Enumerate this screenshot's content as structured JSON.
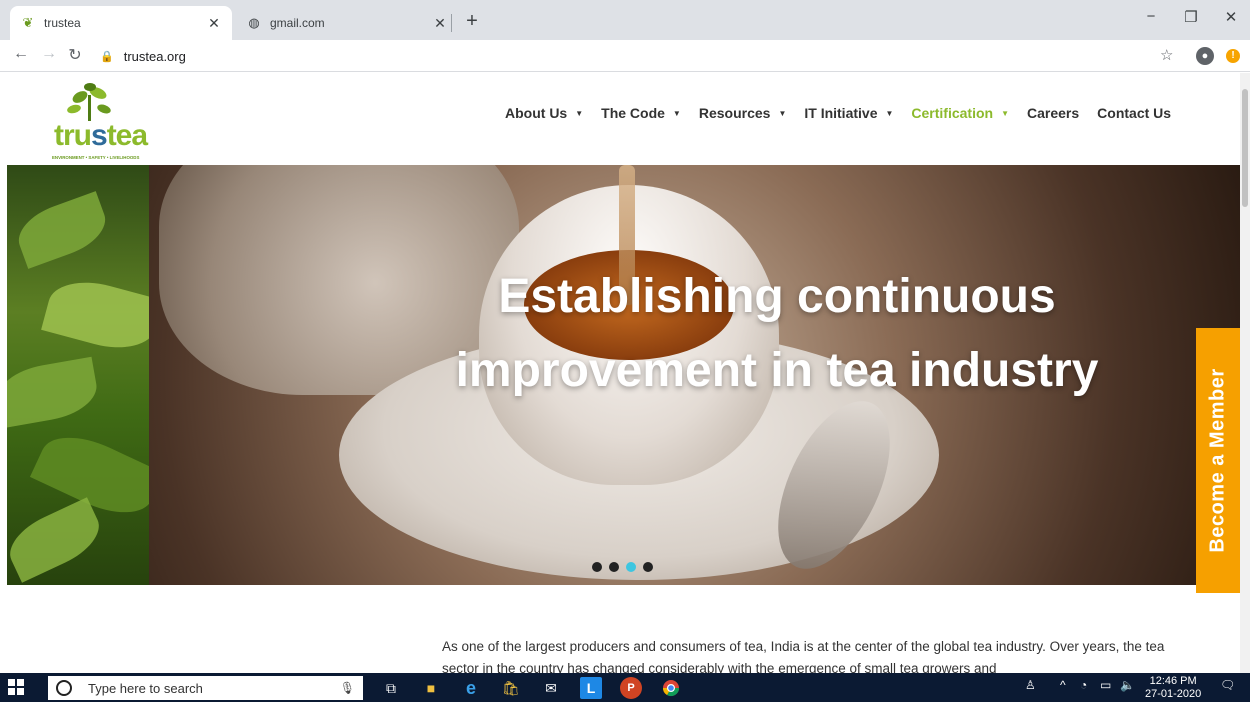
{
  "browser": {
    "tabs": [
      {
        "title": "trustea",
        "icon": "tea-leaf-icon",
        "active": true
      },
      {
        "title": "gmail.com",
        "icon": "globe-icon",
        "active": false
      }
    ],
    "url": "trustea.org",
    "window_controls": [
      "−",
      "❐",
      "✕"
    ]
  },
  "site": {
    "logo": {
      "wordmark": "trustea",
      "tagline": "ENVIRONMENT • SAFETY • LIVELIHOODS"
    },
    "nav": [
      {
        "label": "About Us",
        "dropdown": true
      },
      {
        "label": "The Code",
        "dropdown": true
      },
      {
        "label": "Resources",
        "dropdown": true
      },
      {
        "label": "IT Initiative",
        "dropdown": true
      },
      {
        "label": "Certification",
        "dropdown": true,
        "active": true
      },
      {
        "label": "Careers",
        "dropdown": false
      },
      {
        "label": "Contact Us",
        "dropdown": false
      }
    ],
    "hero": {
      "headline_line1": "Establishing continuous",
      "headline_line2": "improvement in tea industry",
      "slides": 4,
      "active_slide": 3
    },
    "member_cta": "Become a Member",
    "intro_text": "As one of the largest producers and consumers of tea, India is at the center of the global tea industry. Over years, the tea sector in the country has changed considerably with the emergence of small tea growers and"
  },
  "taskbar": {
    "search_placeholder": "Type here to search",
    "time": "12:46 PM",
    "date": "27-01-2020"
  },
  "colors": {
    "accent_green": "#8cba2c",
    "cta_orange": "#f6a000",
    "active_dot": "#3ec6e0"
  }
}
